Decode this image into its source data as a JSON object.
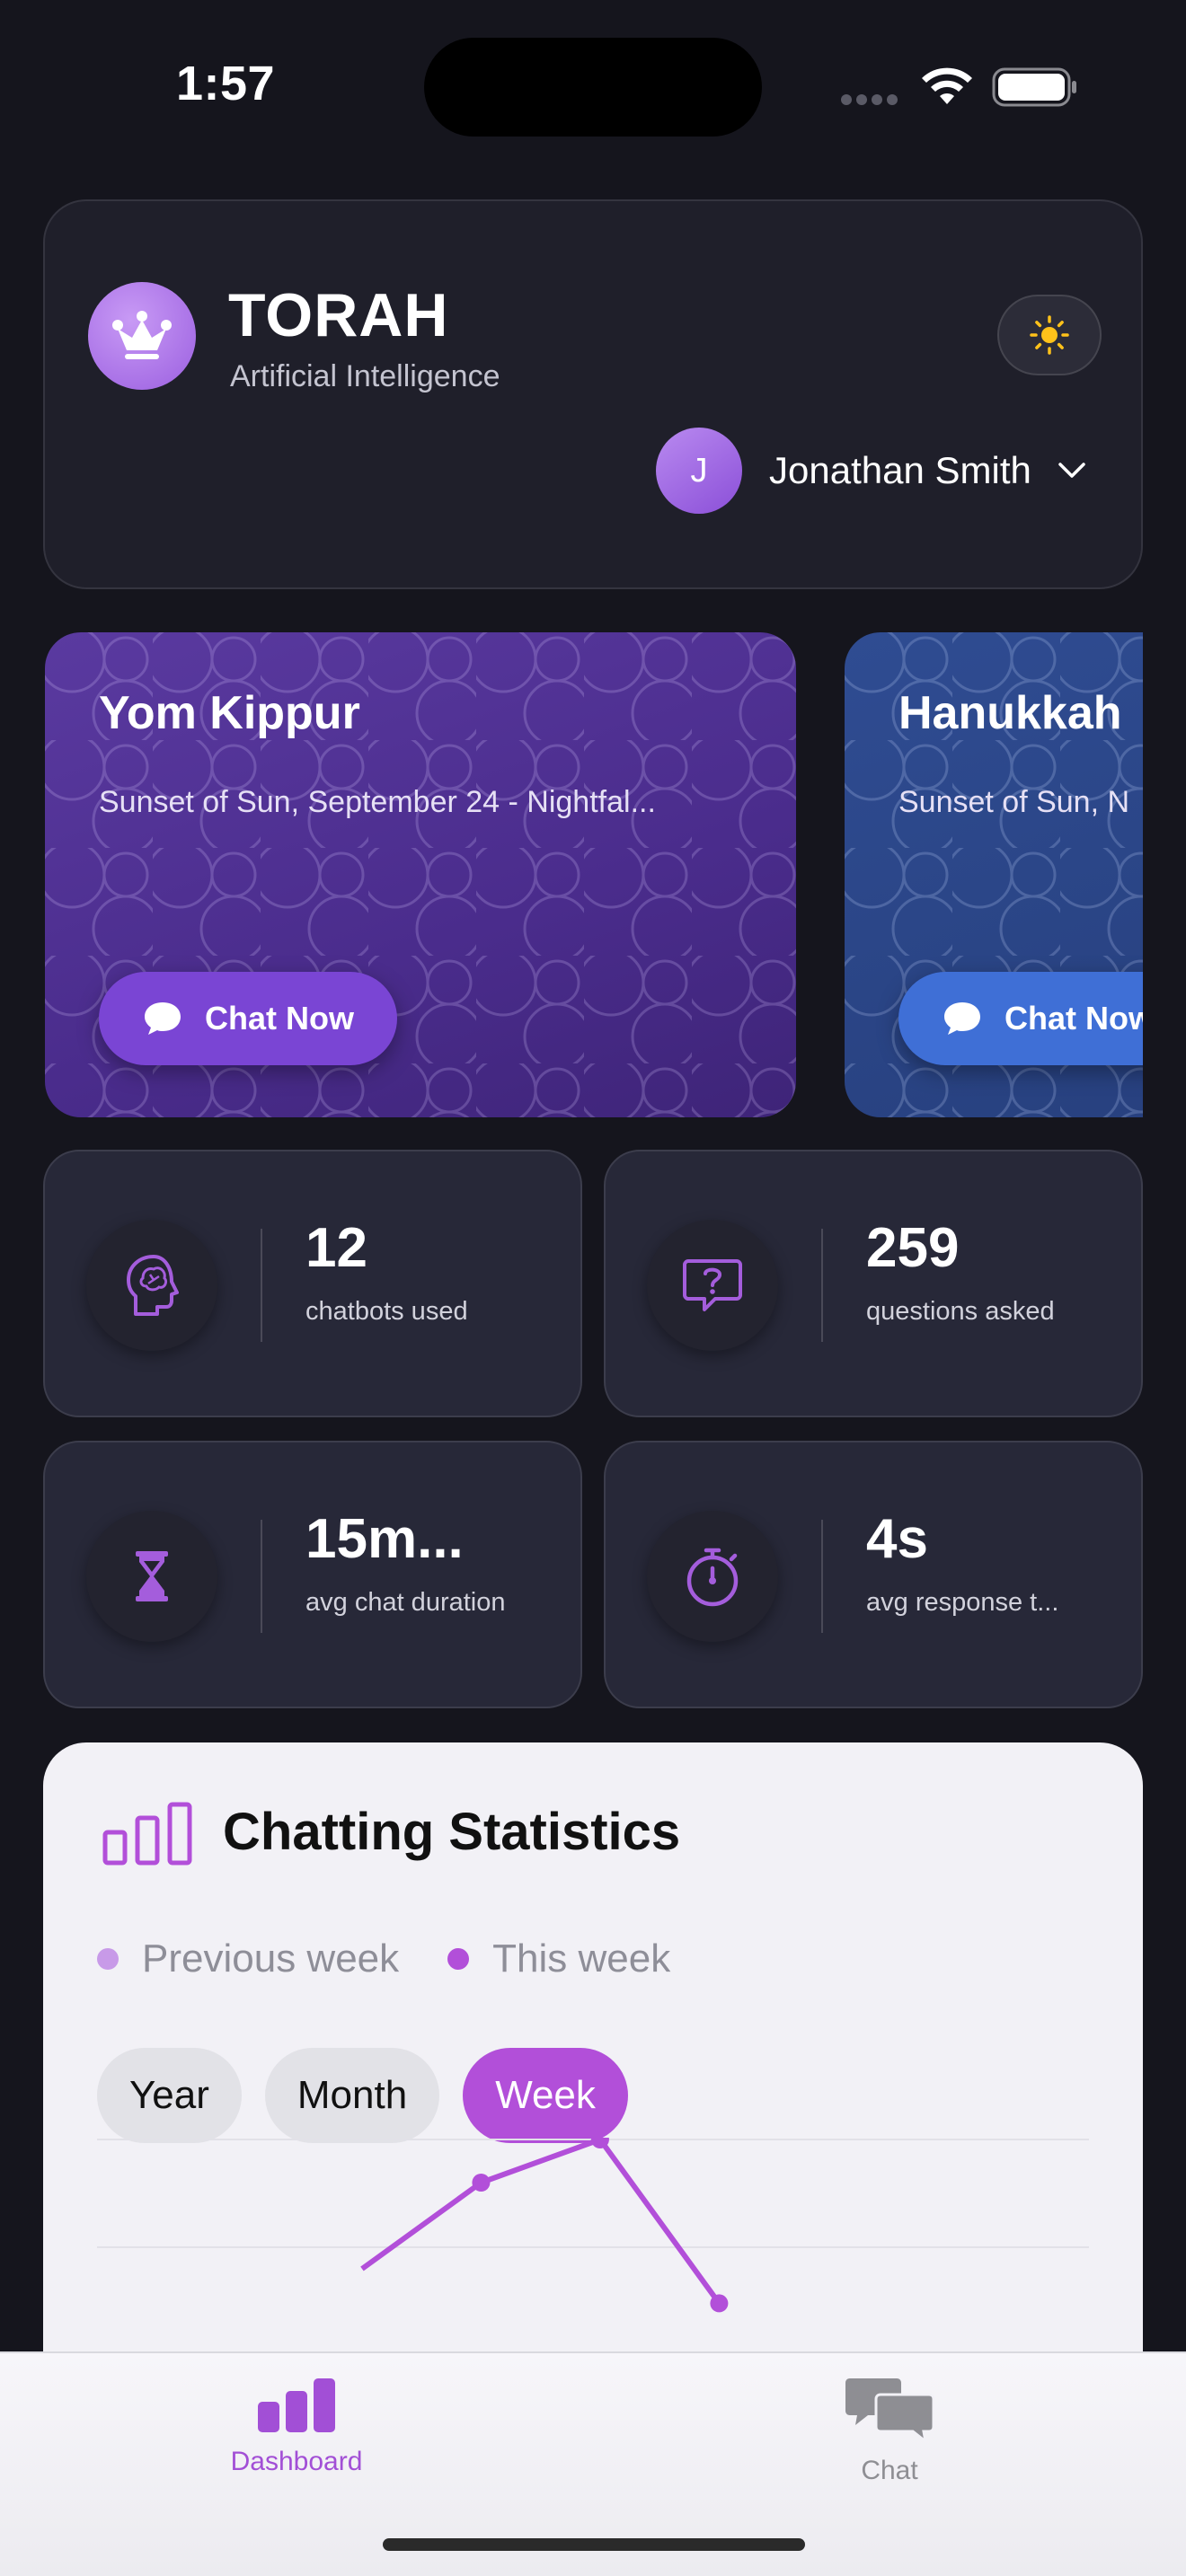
{
  "status_bar": {
    "time": "1:57"
  },
  "header": {
    "app_title": "TORAH",
    "app_subtitle": "Artificial Intelligence",
    "user": {
      "initial": "J",
      "name": "Jonathan Smith"
    }
  },
  "holidays": [
    {
      "title": "Yom Kippur",
      "subtitle": "Sunset of Sun, September 24 - Nightfal...",
      "button": "Chat Now",
      "color": "#4a2c8c"
    },
    {
      "title": "Hanukkah",
      "subtitle": "Sunset of Sun, N",
      "button": "Chat Now",
      "color": "#27407e"
    }
  ],
  "stats": [
    {
      "value": "12",
      "label": "chatbots used",
      "icon": "brain-head-icon"
    },
    {
      "value": "259",
      "label": "questions asked",
      "icon": "question-bubble-icon"
    },
    {
      "value": "15m...",
      "label": "avg chat duration",
      "icon": "hourglass-icon"
    },
    {
      "value": "4s",
      "label": "avg response t...",
      "icon": "stopwatch-icon"
    }
  ],
  "statistics": {
    "title": "Chatting Statistics",
    "legend": [
      {
        "label": "Previous week",
        "color": "#c89ae8"
      },
      {
        "label": "This week",
        "color": "#b24fd9"
      }
    ],
    "ranges": [
      "Year",
      "Month",
      "Week"
    ],
    "active_range": "Week"
  },
  "chart_data": {
    "type": "line",
    "title": "Chatting Statistics",
    "series": [
      {
        "name": "This week",
        "color": "#b24fd9",
        "values": [
          null,
          null,
          5,
          7,
          8,
          4.2,
          null
        ]
      }
    ],
    "note_visible_points": "only the visible portion of the line is shown; remaining points are hidden below the tab bar"
  },
  "tabs": [
    {
      "label": "Dashboard",
      "icon": "bar-chart-icon",
      "active": true
    },
    {
      "label": "Chat",
      "icon": "chat-bubbles-icon",
      "active": false
    }
  ],
  "colors": {
    "accent": "#b24fd9",
    "background": "#15151d",
    "card": "#272838"
  }
}
